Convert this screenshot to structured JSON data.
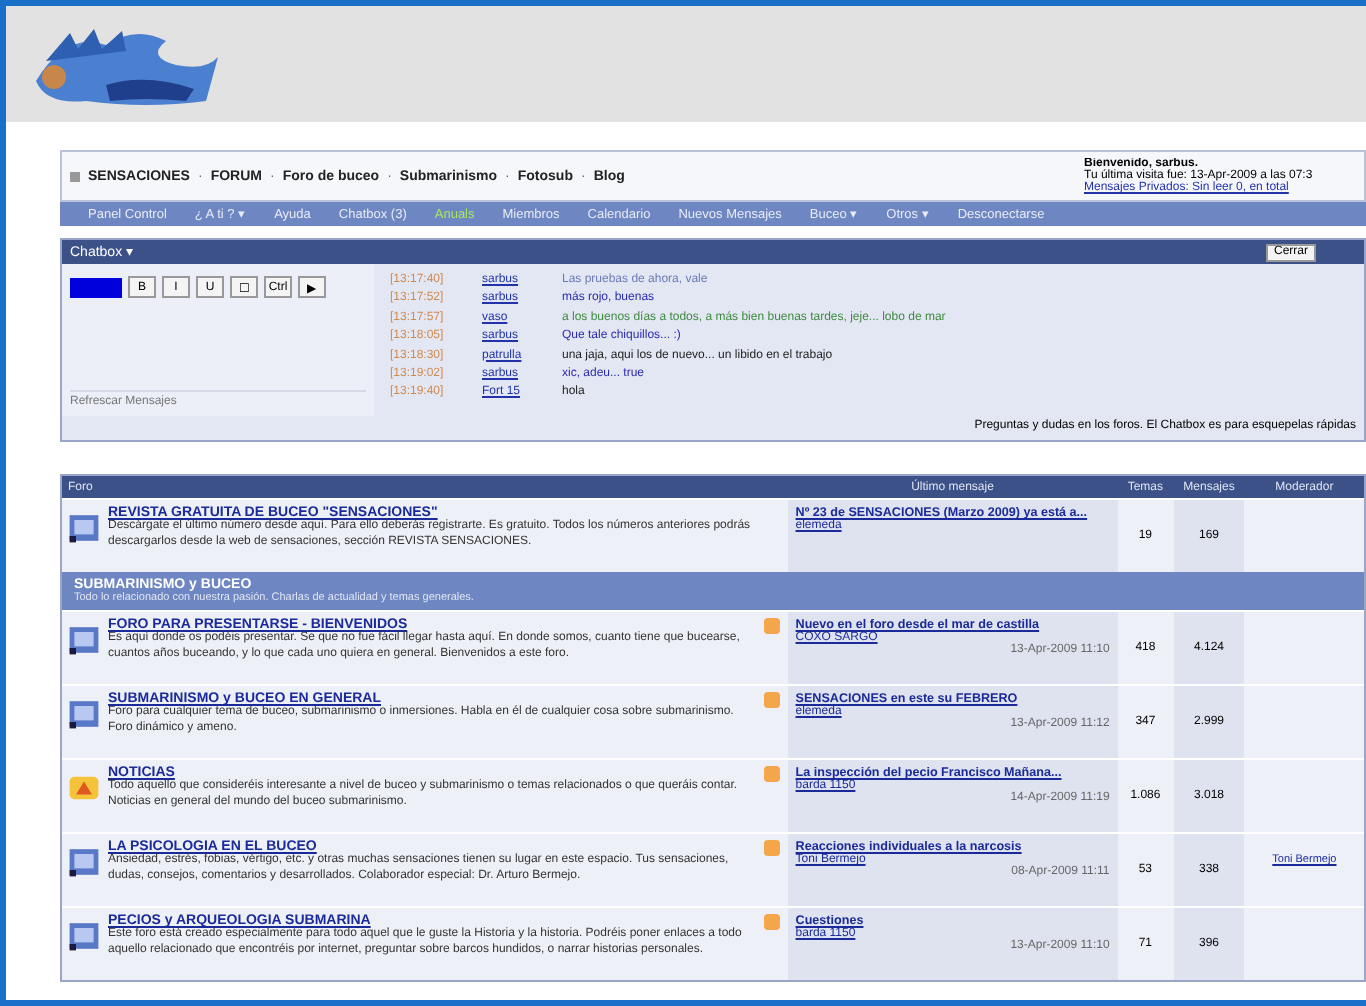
{
  "breadcrumb": {
    "home": "SENSACIONES",
    "separator": "·",
    "links": [
      "FORUM",
      "Foro de buceo",
      "Submarinismo",
      "Fotosub",
      "Blog"
    ]
  },
  "welcome": {
    "greeting": "Bienvenido, sarbus.",
    "last_visit": "Tu última visita fue: 13-Apr-2009 a las 07:3",
    "messages": "Mensajes Privados: Sin leer 0, en total"
  },
  "menu": [
    {
      "label": "Panel Control",
      "selected": false
    },
    {
      "label": "¿ A ti ? ▾",
      "selected": false
    },
    {
      "label": "Ayuda",
      "selected": false
    },
    {
      "label": "Chatbox (3)",
      "selected": false
    },
    {
      "label": "Anuals",
      "selected": true
    },
    {
      "label": "Miembros",
      "selected": false
    },
    {
      "label": "Calendario",
      "selected": false
    },
    {
      "label": "Nuevos Mensajes",
      "selected": false
    },
    {
      "label": "Buceo ▾",
      "selected": false
    },
    {
      "label": "Otros ▾",
      "selected": false
    },
    {
      "label": "Desconectarse",
      "selected": false
    }
  ],
  "chatbox": {
    "title": "Chatbox ▾",
    "close": "Cerrar",
    "tools": [
      "B",
      "I",
      "U",
      "☐",
      "Ctrl",
      "▶"
    ],
    "refresh": "Refrescar Mensajes",
    "footer": "Preguntas y dudas en los foros. El Chatbox es para esquepelas rápidas",
    "messages": [
      {
        "time": "[13:17:40]",
        "user": "sarbus",
        "text": "Las pruebas de ahora, vale",
        "color": "#6a7ab8"
      },
      {
        "time": "[13:17:52]",
        "user": "sarbus",
        "text": "más rojo, buenas",
        "color": "#2a2ab0"
      },
      {
        "time": "[13:17:57]",
        "user": "vaso",
        "text": "a los buenos días a todos, a más bien buenas tardes, jeje... lobo de mar",
        "color": "#3f8a3f"
      },
      {
        "time": "[13:18:05]",
        "user": "sarbus",
        "text": "Que tale chiquillos... :)",
        "color": "#2a2ab0"
      },
      {
        "time": "[13:18:30]",
        "user": "patrulla",
        "text": "una jaja, aqui los de nuevo... un libido en el trabajo",
        "color": "#222222"
      },
      {
        "time": "[13:19:02]",
        "user": "sarbus",
        "text": "xic, adeu... true",
        "color": "#2a2ab0"
      },
      {
        "time": "[13:19:40]",
        "user": "Fort 15",
        "text": "hola",
        "color": "#222222"
      }
    ]
  },
  "forum_table": {
    "columns": [
      "Foro",
      "Último mensaje",
      "Temas",
      "Mensajes",
      "Moderador"
    ],
    "sections": [
      {
        "forums": [
          {
            "kind": "magazine",
            "title": "REVISTA GRATUITA DE BUCEO \"SENSACIONES\"",
            "description": "Descárgate el último número desde aquí. Para ello deberás registrarte. Es gratuito. Todos los números anteriores podrás descargarlos desde la web de sensaciones, sección REVISTA SENSACIONES.",
            "rss": false,
            "last_title": "Nº 23 de SENSACIONES (Marzo 2009) ya está a...",
            "last_by": "elemeda",
            "threads": "19",
            "posts": "169"
          }
        ]
      },
      {
        "title": "SUBMARINISMO y BUCEO",
        "subtitle": "Todo lo relacionado con nuestra pasión. Charlas de actualidad y temas generales.",
        "forums": [
          {
            "kind": "forum",
            "title": "FORO PARA PRESENTARSE - BIENVENIDOS",
            "description": "Es aquí donde os podéis presentar. Se que no fue fácil llegar hasta aquí. En donde somos, cuanto tiene que bucearse, cuantos años buceando, y lo que cada uno quiera en general. Bienvenidos a este foro.",
            "rss": true,
            "last_title": "Nuevo en el foro desde el mar de castilla",
            "last_by": "COXO SARGO",
            "last_date": "13-Apr-2009 11:10",
            "threads": "418",
            "posts": "4.124"
          },
          {
            "kind": "forum",
            "title": "SUBMARINISMO y BUCEO EN GENERAL",
            "description": "Foro para cualquier tema de buceo, submarinismo o inmersiones. Habla en él de cualquier cosa sobre submarinismo. Foro dinámico y ameno.",
            "rss": true,
            "last_title": "SENSACIONES en este su FEBRERO",
            "last_by": "elemeda",
            "last_date": "13-Apr-2009 11:12",
            "threads": "347",
            "posts": "2.999"
          },
          {
            "kind": "news",
            "title": "NOTICIAS",
            "description": "Todo aquello que consideréis interesante a nivel de buceo y submarinismo o temas relacionados o que queráis contar. Noticias en general del mundo del buceo submarinismo.",
            "rss": true,
            "last_title": "La inspección del pecio Francisco Mañana...",
            "last_by": "barda 1150",
            "last_date": "14-Apr-2009 11:19",
            "threads": "1.086",
            "posts": "3.018"
          },
          {
            "kind": "forum",
            "title": "LA PSICOLOGIA EN EL BUCEO",
            "description": "Ansiedad, estrés, fobias, vértigo, etc. y otras muchas sensaciones tienen su lugar en este espacio. Tus sensaciones, dudas, consejos, comentarios y desarrollados. Colaborador especial: Dr. Arturo Bermejo.",
            "rss": true,
            "last_title": "Reacciones individuales a la narcosis",
            "last_by": "Toni Bermejo",
            "last_date": "08-Apr-2009 11:11",
            "threads": "53",
            "posts": "338",
            "moderator": "Toni Bermejo"
          },
          {
            "kind": "forum",
            "title": "PECIOS y ARQUEOLOGIA SUBMARINA",
            "description": "Este foro está creado especialmente para todo aquel que le guste la Historia y la historia. Podréis poner enlaces a todo aquello relacionado que encontréis por internet, preguntar sobre barcos hundidos, o narrar historias personales.",
            "rss": true,
            "last_title": "Cuestiones",
            "last_by": "barda 1150",
            "last_date": "13-Apr-2009 11:10",
            "threads": "71",
            "posts": "396"
          }
        ]
      }
    ]
  }
}
